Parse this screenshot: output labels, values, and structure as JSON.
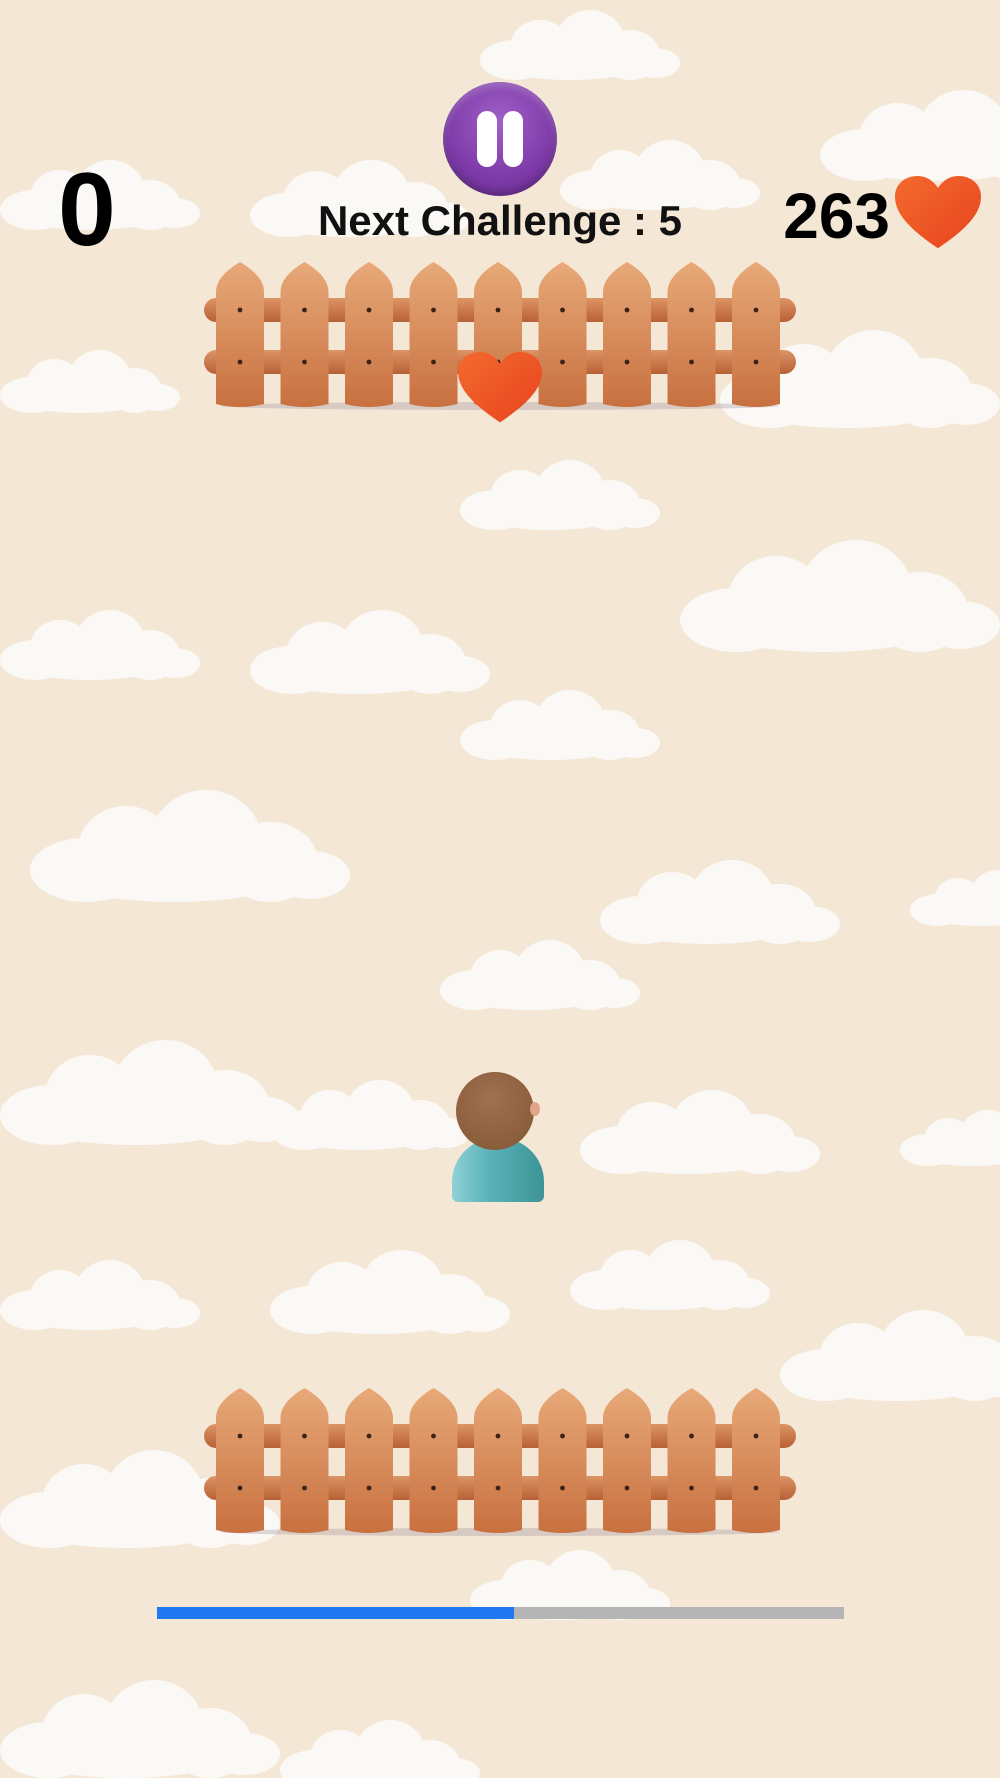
{
  "hud": {
    "score": "0",
    "next_challenge_label": "Next Challenge : 5",
    "hearts_count": "263",
    "pause_icon": "pause-icon",
    "heart_icon": "heart-icon"
  },
  "progress": {
    "fraction": 0.52
  },
  "colors": {
    "background": "#f5e7d6",
    "pause_button": "#7d3aa8",
    "heart": "#f05a2a",
    "progress_fill": "#1f78f0",
    "progress_track": "#b5b5b5"
  }
}
